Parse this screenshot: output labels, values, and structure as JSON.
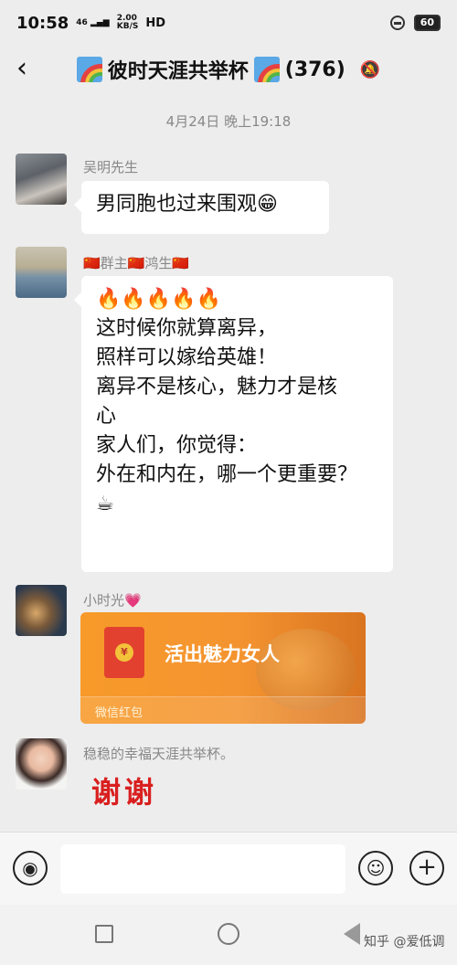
{
  "status_bar": {
    "time": "10:58",
    "signal_text": "46",
    "net_speed": "2.00",
    "net_unit": "KB/S",
    "hd": "HD",
    "battery": "60"
  },
  "header": {
    "title": "彼时天涯共举杯",
    "member_count": "(376)",
    "back_icon": "chevron-left-icon",
    "mute_icon": "bell-mute-icon"
  },
  "timestamp": "4月24日 晚上19:18",
  "messages": [
    {
      "sender": "吴明先生",
      "text": "男同胞也过来围观😁"
    },
    {
      "sender": "🇨🇳群主🇨🇳鸿生🇨🇳",
      "lines": [
        "🔥🔥🔥🔥🔥",
        "这时候你就算离异，",
        "照样可以嫁给英雄！",
        "离异不是核心，魅力才是核",
        "心",
        "家人们，你觉得：",
        "外在和内在，哪一个更重要？",
        "☕"
      ]
    },
    {
      "sender": "小时光💗",
      "red_packet": {
        "title": "活出魅力女人",
        "footer": "微信红包",
        "coin": "¥"
      }
    },
    {
      "sender": "稳稳的幸福天涯共举杯。",
      "sticker_text": "谢谢"
    }
  ],
  "input_bar": {
    "voice_icon": "voice-icon",
    "emoji_icon": "emoji-icon",
    "plus_icon": "plus-icon"
  },
  "watermark": "知乎 @爱低调",
  "colors": {
    "background": "#ededed",
    "bubble": "#ffffff",
    "red_packet": "#f79a2a",
    "thanks_red": "#d91f1f"
  }
}
